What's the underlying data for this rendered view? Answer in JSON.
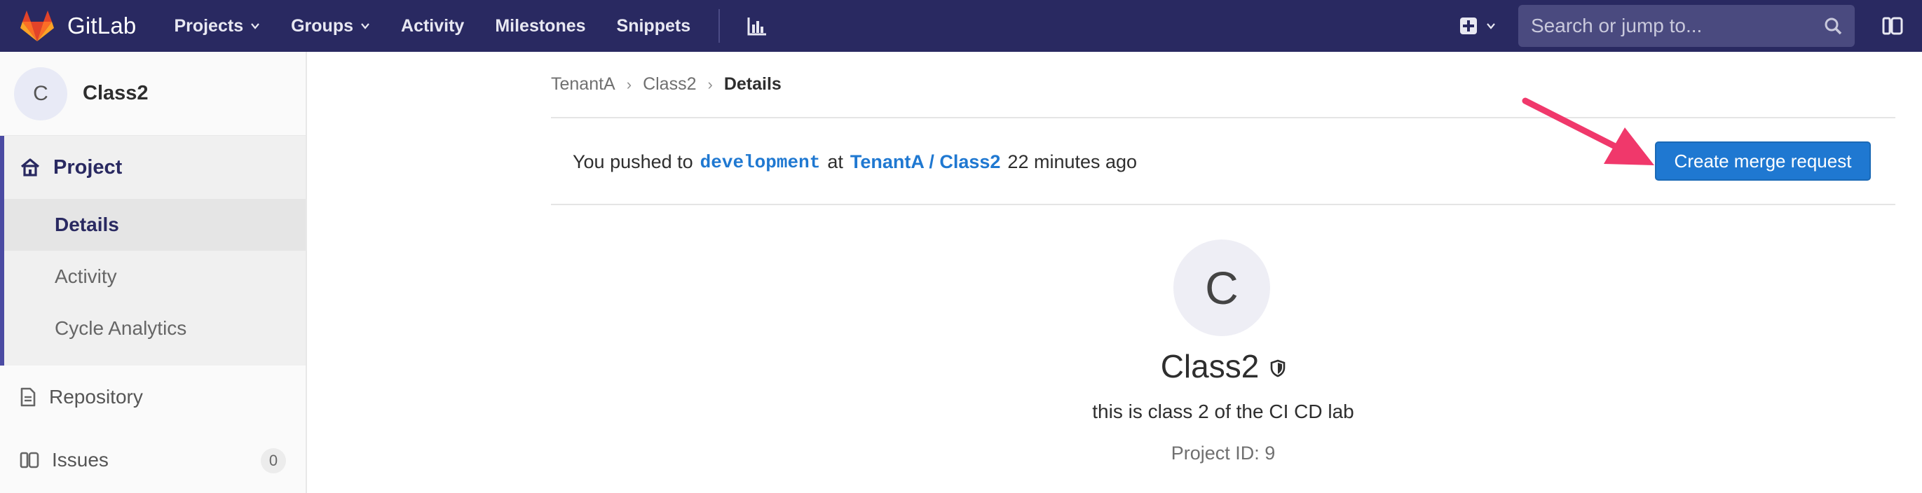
{
  "navbar": {
    "brand": "GitLab",
    "links": [
      {
        "label": "Projects",
        "dropdown": true
      },
      {
        "label": "Groups",
        "dropdown": true
      },
      {
        "label": "Activity",
        "dropdown": false
      },
      {
        "label": "Milestones",
        "dropdown": false
      },
      {
        "label": "Snippets",
        "dropdown": false
      }
    ],
    "search_placeholder": "Search or jump to...",
    "icons": [
      "gitlab-logo",
      "chart-icon",
      "plus-square-icon",
      "search-icon",
      "sidebar-panel-icon"
    ],
    "colors": {
      "bar": "#292961",
      "search_bg": "#4a4a7f"
    }
  },
  "sidebar": {
    "project_avatar_letter": "C",
    "project_name": "Class2",
    "group": {
      "label": "Project",
      "icon": "home-icon",
      "items": [
        {
          "label": "Details",
          "active": true
        },
        {
          "label": "Activity",
          "active": false
        },
        {
          "label": "Cycle Analytics",
          "active": false
        }
      ]
    },
    "items": [
      {
        "label": "Repository",
        "icon": "document-icon"
      },
      {
        "label": "Issues",
        "icon": "issues-icon",
        "badge": "0"
      }
    ]
  },
  "breadcrumb": {
    "items": [
      "TenantA",
      "Class2"
    ],
    "current": "Details"
  },
  "push_banner": {
    "prefix": "You pushed to",
    "branch": "development",
    "at": "at",
    "project": "TenantA / Class2",
    "time": "22 minutes ago",
    "button_label": "Create merge request",
    "button_color": "#1f78d1",
    "arrow_color": "#f0386b"
  },
  "project": {
    "avatar_letter": "C",
    "title": "Class2",
    "visibility_icon": "shield-icon",
    "description": "this is class 2 of the CI CD lab",
    "id_text": "Project ID: 9"
  }
}
